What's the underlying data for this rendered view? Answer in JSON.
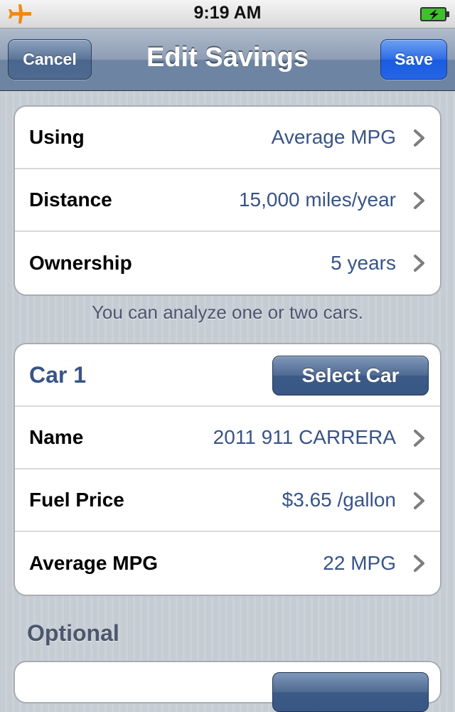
{
  "status_bar": {
    "time": "9:19 AM",
    "left_icon": "airplane-icon",
    "right_icon": "battery-charging-icon"
  },
  "nav": {
    "title": "Edit Savings",
    "cancel_label": "Cancel",
    "save_label": "Save"
  },
  "settings": {
    "rows": [
      {
        "label": "Using",
        "value": "Average MPG"
      },
      {
        "label": "Distance",
        "value": "15,000 miles/year"
      },
      {
        "label": "Ownership",
        "value": "5 years"
      }
    ],
    "footer": "You can analyze one or two cars."
  },
  "car1": {
    "title": "Car 1",
    "select_label": "Select Car",
    "rows": [
      {
        "label": "Name",
        "value": "2011 911 CARRERA"
      },
      {
        "label": "Fuel Price",
        "value": "$3.65 /gallon"
      },
      {
        "label": "Average MPG",
        "value": "22 MPG"
      }
    ]
  },
  "optional": {
    "header": "Optional"
  },
  "colors": {
    "value_text": "#385487",
    "nav_bar": "#6d84a2",
    "save_button": "#2466e6"
  }
}
